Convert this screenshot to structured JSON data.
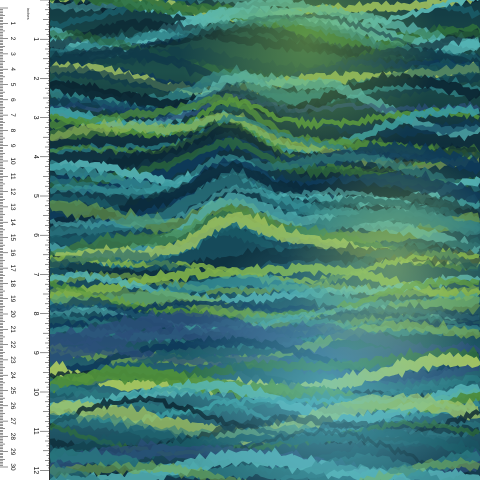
{
  "ruler": {
    "units_label": "inches",
    "cm_labels": [
      "1",
      "2",
      "3",
      "4",
      "5",
      "6",
      "7",
      "8",
      "9",
      "10",
      "11",
      "12",
      "13",
      "14",
      "15",
      "16",
      "17",
      "18",
      "19",
      "20",
      "21",
      "22",
      "23",
      "24",
      "25",
      "26",
      "27",
      "28",
      "29",
      "30"
    ],
    "inch_labels": [
      "1",
      "2",
      "3",
      "4",
      "5",
      "6",
      "7",
      "8",
      "9",
      "10",
      "11",
      "12"
    ]
  },
  "fabric": {
    "pattern": "wavy-glitch-stripes",
    "colors": [
      "#0a2430",
      "#103a4a",
      "#1a5a66",
      "#2a7a82",
      "#3a9aa0",
      "#56b6b8",
      "#2f6f3a",
      "#4f8f3a",
      "#7fb04a",
      "#a8c860",
      "#0e3a5a",
      "#2b4f7a"
    ]
  }
}
